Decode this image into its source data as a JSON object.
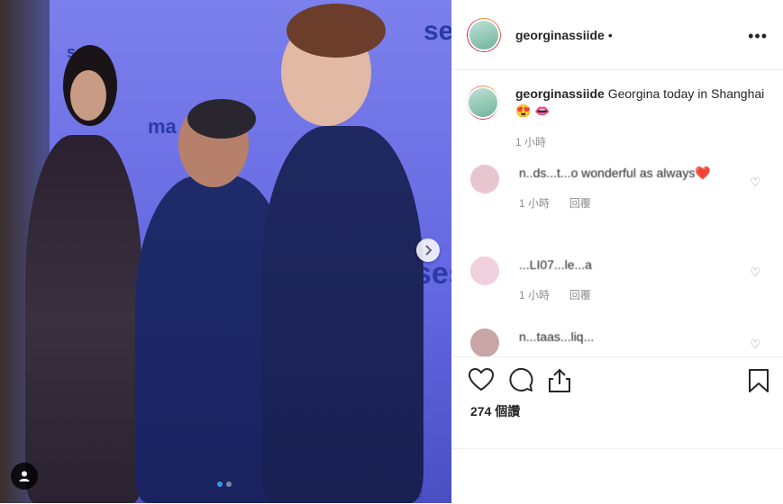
{
  "photo": {
    "brand_texts": [
      "se",
      "se",
      "ma",
      "ses",
      "se"
    ],
    "next_icon": "chevron-right-icon",
    "carousel_dots": 2,
    "active_dot": 0,
    "user_tag_icon": "user-icon"
  },
  "header": {
    "username": "georginassiide",
    "separator": "•",
    "more_icon": "more-horizontal-icon"
  },
  "caption": {
    "username": "georginassiide",
    "text": " Georgina today in Shanghai 😍 👄",
    "time": "1 小時"
  },
  "comments": [
    {
      "text": "n..ds...t...o wonderful as always❤️",
      "time": "1 小時",
      "reply": "回覆"
    },
    {
      "text": "...LI07...le...a",
      "time": "1 小時",
      "reply": "回覆"
    },
    {
      "text": "n...taas...liq...",
      "time": "",
      "reply": ""
    }
  ],
  "actions": {
    "like_icon": "heart-icon",
    "comment_icon": "comment-icon",
    "share_icon": "share-icon",
    "save_icon": "bookmark-icon",
    "likes_text": "274 個讚"
  },
  "colors": {
    "accent": "#3897f0",
    "muted": "#8e8e8e",
    "text": "#262626"
  }
}
